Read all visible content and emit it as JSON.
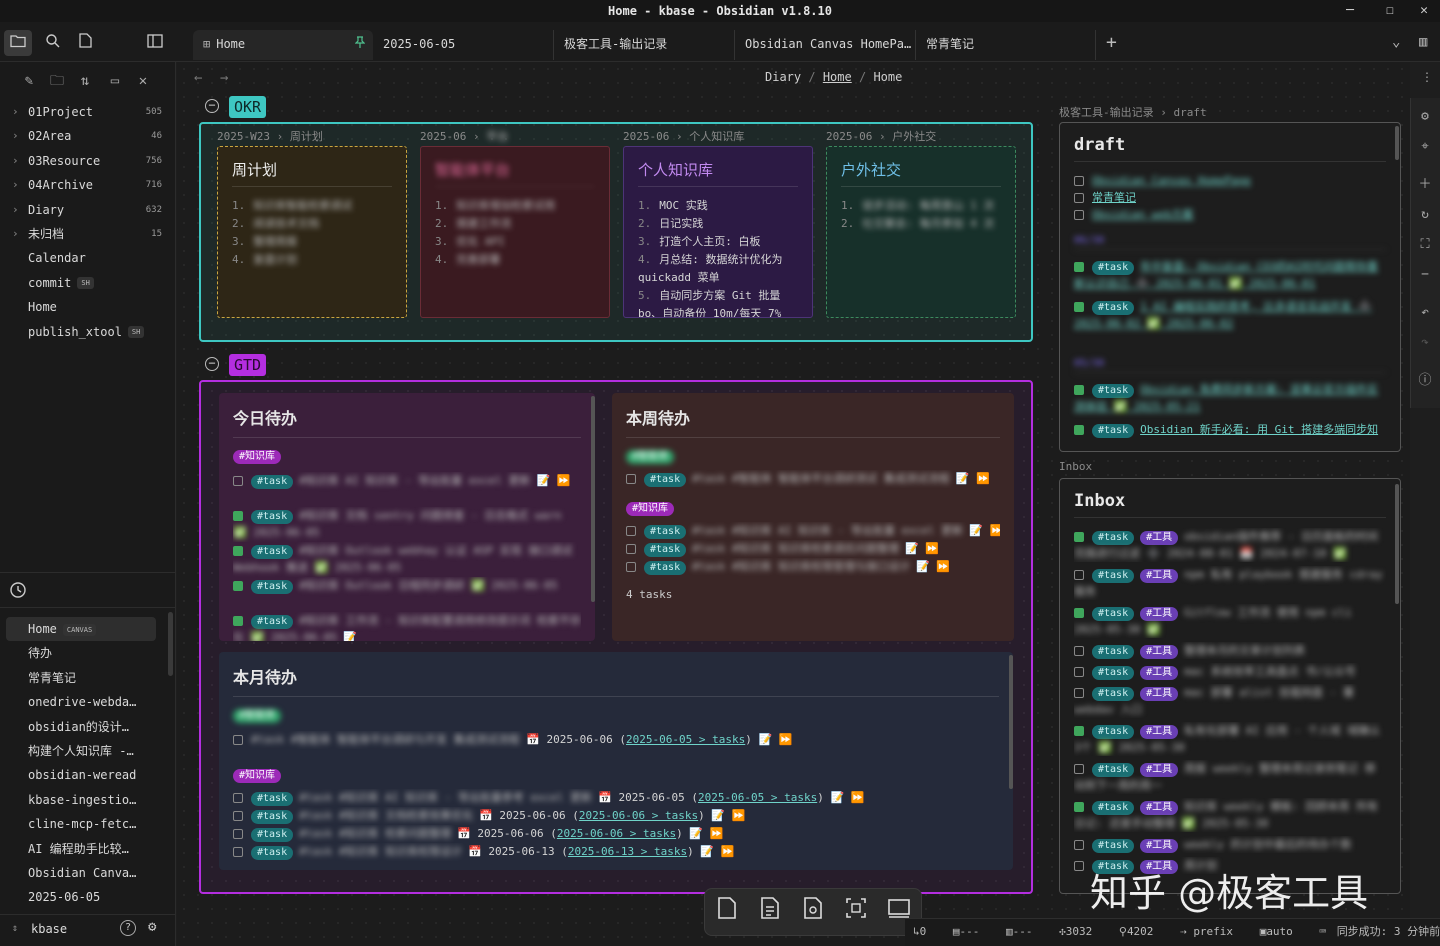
{
  "window": {
    "title": "Home - kbase - Obsidian v1.8.10",
    "min": "─",
    "max": "☐",
    "close": "✕"
  },
  "ribbon": {
    "files_icon": "folder-icon",
    "search_icon": "search-icon",
    "bookmark_icon": "file-icon",
    "sidebar_toggle_icon": "sidebar-icon"
  },
  "tabs": [
    {
      "label": "Home",
      "icon": "⊞",
      "pin": "📌"
    },
    {
      "label": "2025-06-05"
    },
    {
      "label": "极客工具-输出记录"
    },
    {
      "label": "Obsidian Canvas HomePa…"
    },
    {
      "label": "常青笔记"
    }
  ],
  "tabbar": {
    "new_tab": "+",
    "dropdown": "⌄",
    "layout": "▥"
  },
  "file_tree": [
    {
      "label": "01Project",
      "count": "505",
      "folder": true
    },
    {
      "label": "02Area",
      "count": "46",
      "folder": true
    },
    {
      "label": "03Resource",
      "count": "756",
      "folder": true
    },
    {
      "label": "04Archive",
      "count": "716",
      "folder": true
    },
    {
      "label": "Diary",
      "count": "632",
      "folder": true
    },
    {
      "label": "未归档",
      "count": "15",
      "folder": true
    },
    {
      "label": "Calendar",
      "count": "",
      "folder": false
    },
    {
      "label": "commit",
      "count": "",
      "badge": "SH",
      "folder": false
    },
    {
      "label": "Home",
      "count": "",
      "folder": false
    },
    {
      "label": "publish_xtool",
      "count": "",
      "badge": "SH",
      "folder": false
    }
  ],
  "recent": [
    {
      "label": "Home",
      "badge": "CANVAS",
      "active": true
    },
    {
      "label": "待办"
    },
    {
      "label": "常青笔记"
    },
    {
      "label": "onedrive-webda…"
    },
    {
      "label": "obsidian的设计…"
    },
    {
      "label": "构建个人知识库 -…"
    },
    {
      "label": "obsidian-weread"
    },
    {
      "label": "kbase-ingestio…"
    },
    {
      "label": "cline-mcp-fetc…"
    },
    {
      "label": "AI 编程助手比较…"
    },
    {
      "label": "Obsidian Canva…"
    },
    {
      "label": "2025-06-05"
    }
  ],
  "vault": {
    "name": "kbase",
    "help": "?",
    "settings": "⚙"
  },
  "breadcrumb": {
    "a": "Diary",
    "sep": "/",
    "b": "Home",
    "c": "Home"
  },
  "okr": {
    "label": "OKR",
    "cards": [
      {
        "cap1": "2025-W23",
        "cap2": "周计划",
        "title": "周计划",
        "items": [
          "知识库智能检索调试",
          "阅读技术文档",
          "整理周报",
          "复盘计划"
        ],
        "blur_title": false,
        "blur_items": true
      },
      {
        "cap1": "2025-06",
        "cap2": "平台",
        "title": "智能体平台",
        "items": [
          "知识库增加检索试用",
          "搭建工作流",
          "优化 API",
          "完善部署"
        ],
        "blur_title": true,
        "blur_items": true
      },
      {
        "cap1": "2025-06",
        "cap2": "个人知识库",
        "title": "个人知识库",
        "items": [
          "MOC 实践",
          "日记实践",
          "打造个人主页: 白板",
          "月总结: 数据统计优化为 quickadd 菜单",
          "自动同步方案 Git 批量 bo、自动备份 10m/每天 7%"
        ],
        "blur_title": false,
        "blur_items": false
      },
      {
        "cap1": "2025-06",
        "cap2": "户外社交",
        "title": "户外社交",
        "items": [
          "徒步活动: 每周登山 1 次",
          "社交聚会: 每月参加 4 次"
        ],
        "blur_title": false,
        "blur_items": true
      }
    ]
  },
  "gtd": {
    "label": "GTD",
    "today": {
      "title": "今日待办",
      "section": "#知识库",
      "rows": [
        {
          "checked": false,
          "text": "#知识库 AI 知识库 - 导出批量 excel 更新",
          "tail": "📝 ⏩"
        },
        {
          "checked": true,
          "text": "#知识库 文档 sentry 问题排查 - 日志格式 warn ✅ 2025-06-05",
          "tail": ""
        },
        {
          "checked": true,
          "text": "#知识库 Outlook webhay 认证 ASP 实现 接口调试 Webhook 推送 ✅ 2025-06-05",
          "tail": ""
        },
        {
          "checked": true,
          "text": "#知识库 Outlook 日程同步调研 ✅ 2025-06-05",
          "tail": ""
        },
        {
          "checked": true,
          "text": "#知识库 工作流 - 知识库配置调用修改提示词 检索不存在 ✅ 2025-06-05",
          "tail": "📝"
        }
      ]
    },
    "week": {
      "title": "本周待办",
      "section1": "#智能体",
      "section2": "#知识库",
      "rows1": [
        {
          "checked": false,
          "text": "#task #智能体 智能体平台调研测试 集成测试流程",
          "tail": "📝 ⏩"
        }
      ],
      "rows2": [
        {
          "checked": false,
          "text": "#task #知识库 AI 知识库 - 导出批量 excel 更新",
          "tail": "📝 ⏩"
        },
        {
          "checked": false,
          "text": "#task #知识库 知识库检索调优问题整理",
          "tail": "📝 ⏩"
        },
        {
          "checked": false,
          "text": "#task #知识库 知识库权限管理与接口设计",
          "tail": "📝 ⏩"
        }
      ],
      "count": "4 tasks"
    },
    "month": {
      "title": "本月待办",
      "section1": "#智能体",
      "section2": "#知识库",
      "row1": {
        "text": "#task #智能体 智能体平台调研与开发 集成测试流程",
        "date": "📅 2025-06-06",
        "link": "2025-06-05 > tasks",
        "tail": "📝 ⏩"
      },
      "rows": [
        {
          "text": "#task #知识库 AI 知识库 - 导出批量参考 excel 更新",
          "date": "📅 2025-06-05",
          "link": "2025-06-05 > tasks"
        },
        {
          "text": "#task #知识库 文档检索效果优化",
          "date": "📅 2025-06-06",
          "link": "2025-06-06 > tasks"
        },
        {
          "text": "#task #知识库 检索问题整理",
          "date": "📅 2025-06-06",
          "link": "2025-06-06 > tasks"
        },
        {
          "text": "#task #知识库 知识库权限设计",
          "date": "📅 2025-06-13",
          "link": "2025-06-13 > tasks"
        }
      ]
    }
  },
  "draft": {
    "caption": "极客工具-输出记录 › draft",
    "title": "draft",
    "links": [
      "Obsidian Canvas HomePage",
      "常青笔记",
      "Obsidian web方案"
    ],
    "sec1": "06/30",
    "items1": [
      {
        "tag": "#task",
        "text": "年中复盘: Obsidian CEO的AI时代问题帮你重新认识自己 ➕ 2025-06-01 ✅ 2025-06-01"
      },
      {
        "tag": "#task",
        "text": "1 AI 编程实践的思考, 比多语言实战开发 ➕ 2025-06-02 ✅ 2025-06-02"
      }
    ],
    "sec2": "05/30",
    "items2": [
      {
        "tag": "#task",
        "text": "Obsidian 免费同步新方案: 坚果云官方插件实测体验 ✅ 2025-05-21"
      },
      {
        "tag": "#task",
        "text": "Obsidian 新手必看: 用 Git 搭建多端同步知"
      }
    ]
  },
  "inbox": {
    "caption": "Inbox",
    "title": "Inbox",
    "items": [
      {
        "checked": true,
        "text": "obsidian插件推荐 - 日历面板的时间范围进行过滤 ➕ 2024-08-01 📅 2024-07-10 ✅ 2025-05-30"
      },
      {
        "checked": false,
        "text": "npm 私有 playbook 搭建服务 cdray 服务"
      },
      {
        "checked": true,
        "text": "Gitflow 工作流 使用 npm cli 2025-05-30 ✅"
      },
      {
        "checked": false,
        "text": "整理本月的文章计划列表"
      },
      {
        "checked": false,
        "text": "mac 系统效率工具盘点 书/公众号"
      },
      {
        "checked": false,
        "text": "mac 部署 alist 挂载网盘 - 署 webdav 入口"
      },
      {
        "checked": true,
        "text": "私有化部署 AI 应用 - 个人域 域确认3个 ✅ 2025-05-30"
      },
      {
        "checked": false,
        "text": "周报 weekly 整理本周记录到笔记 移动到下一周的周一"
      },
      {
        "checked": true,
        "text": "知识库 weekly 模板: 回顾本周 所有日记: 还是手动整理 ✅ 2025-05-30"
      },
      {
        "checked": false,
        "text": "weekly 的计划中最后的待办个数"
      },
      {
        "checked": false,
        "text": "周计划"
      }
    ]
  },
  "statusbar": {
    "backlinks": "0",
    "words": "---",
    "chars": "---",
    "a": "3032",
    "b": "4202",
    "prefix": "prefix",
    "auto": "auto",
    "sync": "同步成功: 3 分钟前",
    "check": "✓ 0"
  },
  "watermark": "知乎 @极客工具",
  "colors": {
    "okr": "#3ec7c2",
    "gtd": "#b42ee0",
    "task_tag": "#1a6f73",
    "kb_tag": "#9c2ab8",
    "tool_tag": "#6a3fb5"
  }
}
